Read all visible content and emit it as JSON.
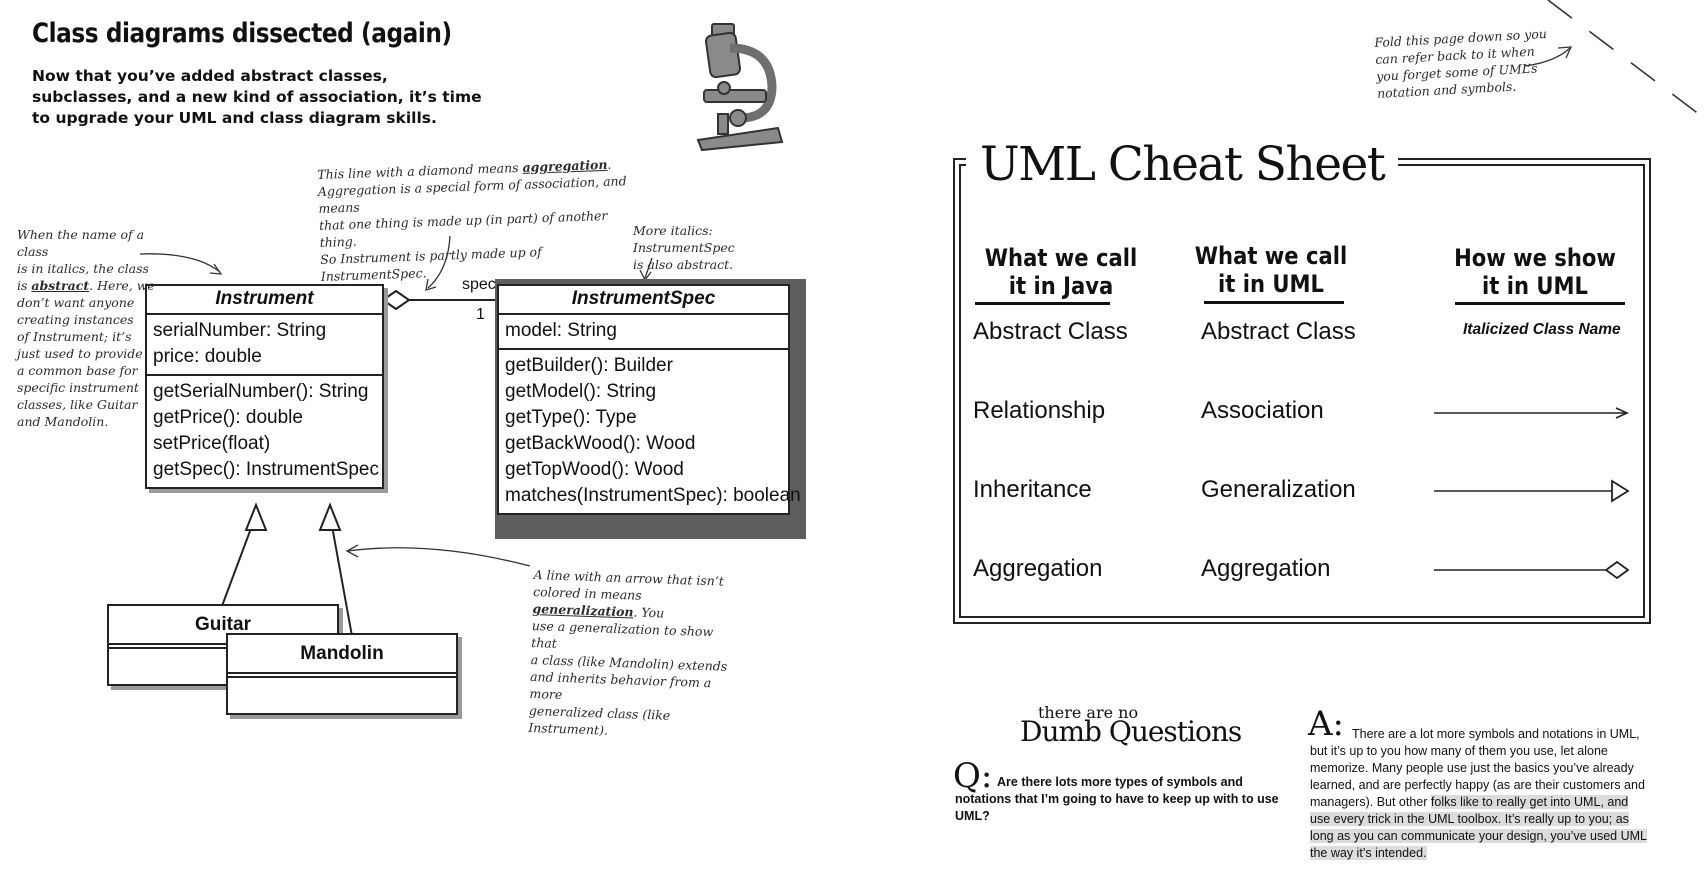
{
  "left_page": {
    "title": "Class diagrams dissected (again)",
    "intro": "Now that you’ve added abstract classes,\nsubclasses, and a new kind of association, it’s time\nto upgrade your UML and class diagram skills."
  },
  "diagram": {
    "instrument": {
      "name": "Instrument",
      "attributes": [
        "serialNumber: String",
        "price: double"
      ],
      "methods": [
        "getSerialNumber(): String",
        "getPrice(): double",
        "setPrice(float)",
        "getSpec(): InstrumentSpec"
      ]
    },
    "instrument_spec": {
      "name": "InstrumentSpec",
      "attributes": [
        "model: String"
      ],
      "methods": [
        "getBuilder(): Builder",
        "getModel(): String",
        "getType(): Type",
        "getBackWood(): Wood",
        "getTopWood(): Wood",
        "matches(InstrumentSpec): boolean"
      ]
    },
    "guitar": {
      "name": "Guitar"
    },
    "mandolin": {
      "name": "Mandolin"
    },
    "association_role": "spec",
    "association_multiplicity": "1"
  },
  "annotations": {
    "abstract_note_pre": "When the name of a class\nis in italics, the class\nis ",
    "abstract_note_word": "abstract",
    "abstract_note_post": ". Here, we\ndon’t want anyone\ncreating instances\nof Instrument; it’s\njust used to provide\na common base for\nspecific instrument\nclasses, like Guitar\nand Mandolin.",
    "aggregation_note_pre": "This line with a diamond means ",
    "aggregation_note_word": "aggregation",
    "aggregation_note_post": ".\nAggregation is a special form of association, and means\nthat one thing is made up (in part) of another thing.\nSo Instrument is partly made up of InstrumentSpec.",
    "italics_note": "More italics: InstrumentSpec\nis also abstract.",
    "generalization_note_pre": "A line with an arrow that isn’t\ncolored in means ",
    "generalization_note_word": "generalization",
    "generalization_note_post": ". You\nuse a generalization to show that\na class (like Mandolin) extends\nand inherits behavior from a more\ngeneralized class (like Instrument).",
    "fold_note": "Fold this page down so you\ncan refer back to it when\nyou forget some of UML’s\nnotation and symbols."
  },
  "cheat_sheet": {
    "title": "UML Cheat Sheet",
    "headers": [
      "What we call\nit in Java",
      "What we call\nit in UML",
      "How we show\nit in UML"
    ],
    "rows": [
      {
        "java": "Abstract Class",
        "uml": "Abstract Class",
        "show": "Italicized Class Name",
        "symbol": "italic-name"
      },
      {
        "java": "Relationship",
        "uml": "Association",
        "show": "",
        "symbol": "arrow"
      },
      {
        "java": "Inheritance",
        "uml": "Generalization",
        "show": "",
        "symbol": "hollow-triangle"
      },
      {
        "java": "Aggregation",
        "uml": "Aggregation",
        "show": "",
        "symbol": "diamond"
      }
    ]
  },
  "dumb_questions": {
    "heading_small": "there are no",
    "heading_big": "Dumb Questions",
    "q_letter": "Q:",
    "question": "Are there lots more types of symbols and notations that I’m going to have to keep up with to use UML?",
    "a_letter": "A:",
    "answer_plain": "There are a lot more symbols and notations in UML, but it’s up to you how many of them you use, let alone memorize. Many people use just the basics you’ve already learned, and are perfectly happy (as are their customers and managers). But other ",
    "answer_highlight": "folks like to really get into UML, and use every trick in the UML toolbox. It’s really up to you; as long as you can communicate your design, you’ve used UML the way it’s intended."
  },
  "colors": {
    "ink": "#222222",
    "shadow": "#5e5e5e",
    "highlight": "#dcdcdc"
  }
}
